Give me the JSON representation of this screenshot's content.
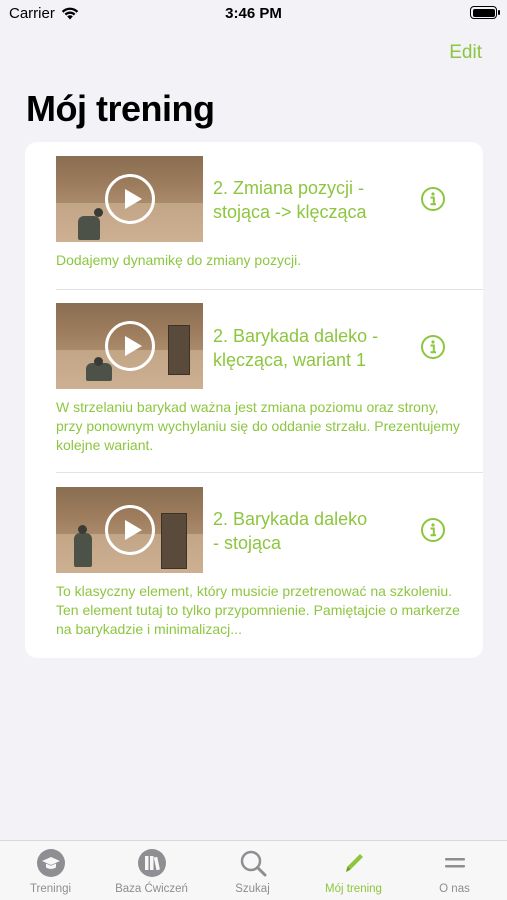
{
  "status_bar": {
    "carrier": "Carrier",
    "time": "3:46 PM"
  },
  "nav": {
    "edit_label": "Edit",
    "title": "Mój trening"
  },
  "items": [
    {
      "title_line1": "2. Zmiana pozycji -",
      "title_line2": "stojąca -> klęcząca",
      "description": "Dodajemy dynamikę do zmiany pozycji."
    },
    {
      "title_line1": "2. Barykada daleko -",
      "title_line2": "klęcząca, wariant 1",
      "description": "W strzelaniu barykad ważna jest zmiana poziomu oraz strony, przy ponownym wychylaniu się do oddanie strzału. Prezentujemy kolejne wariant."
    },
    {
      "title_line1": "2. Barykada daleko",
      "title_line2": "- stojąca",
      "description": "To klasyczny element, który musicie przetrenować na szkoleniu. Ten element tutaj to tylko przypomnienie. Pamiętajcie o markerze na barykadzie i minimalizacj..."
    }
  ],
  "tabs": [
    {
      "label": "Treningi",
      "icon": "graduation-cap-icon",
      "active": false
    },
    {
      "label": "Baza Ćwiczeń",
      "icon": "books-icon",
      "active": false
    },
    {
      "label": "Szukaj",
      "icon": "search-icon",
      "active": false
    },
    {
      "label": "Mój trening",
      "icon": "pencil-icon",
      "active": true
    },
    {
      "label": "O nas",
      "icon": "menu-icon",
      "active": false
    }
  ],
  "colors": {
    "accent": "#8cc63f",
    "inactive": "#8e8e93",
    "background": "#f2f2f7"
  }
}
